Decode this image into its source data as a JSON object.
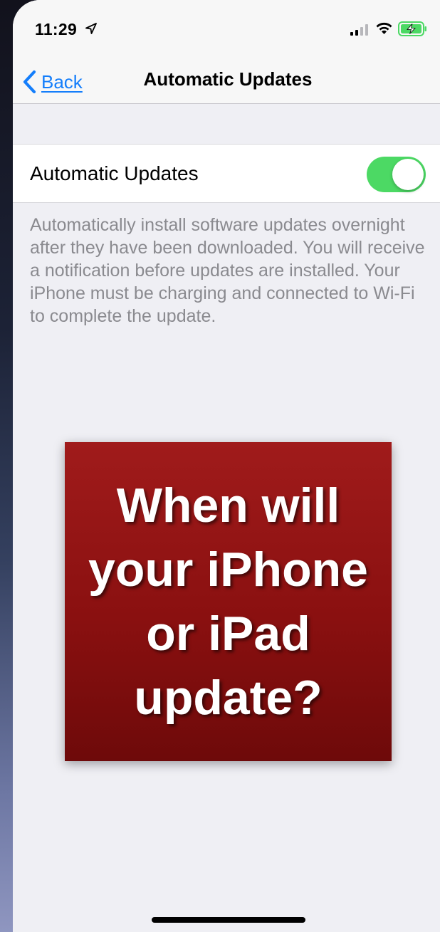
{
  "status_bar": {
    "time": "11:29",
    "icons": [
      "location-arrow-icon",
      "cellular-signal-icon",
      "wifi-icon",
      "battery-charging-icon"
    ],
    "battery_color": "#4cd964"
  },
  "nav": {
    "back_label": "Back",
    "title": "Automatic Updates"
  },
  "settings": {
    "row_label": "Automatic Updates",
    "toggle_on": true,
    "toggle_color": "#4cd964",
    "footer": "Automatically install software updates overnight after they have been downloaded. You will receive a notification before updates are installed. Your iPhone must be charging and connected to Wi-Fi to complete the update."
  },
  "overlay": {
    "text": "When will your iPhone or iPad update?",
    "background_color": "#8a1010"
  },
  "colors": {
    "accent": "#147efb",
    "background": "#efeff4",
    "footer_text": "#8a8a8f"
  }
}
